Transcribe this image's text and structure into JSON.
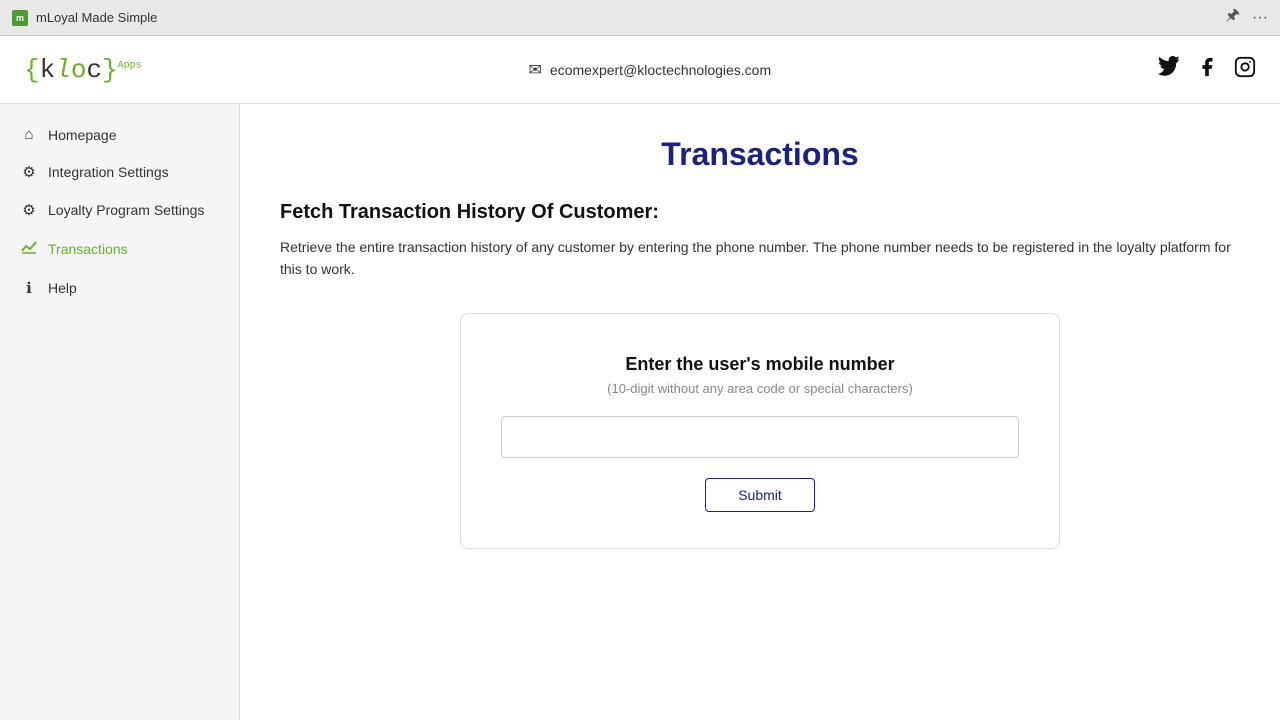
{
  "browser": {
    "tab_label": "mLoyal Made Simple",
    "pin_icon": "📌",
    "more_icon": "···"
  },
  "header": {
    "logo_text": "{kloc}",
    "email": "ecomexpert@kloctechnologies.com",
    "social": [
      "twitter",
      "facebook",
      "instagram"
    ]
  },
  "sidebar": {
    "items": [
      {
        "id": "homepage",
        "label": "Homepage",
        "icon": "home",
        "active": false
      },
      {
        "id": "integration-settings",
        "label": "Integration Settings",
        "icon": "gear",
        "active": false
      },
      {
        "id": "loyalty-program-settings",
        "label": "Loyalty Program Settings",
        "icon": "gear",
        "active": false
      },
      {
        "id": "transactions",
        "label": "Transactions",
        "icon": "chart",
        "active": true
      },
      {
        "id": "help",
        "label": "Help",
        "icon": "info",
        "active": false
      }
    ]
  },
  "main": {
    "page_title": "Transactions",
    "section_title": "Fetch Transaction History Of Customer:",
    "section_desc": "Retrieve the entire transaction history of any customer by entering the phone number. The phone number needs to be registered in the loyalty platform for this to work.",
    "card": {
      "title": "Enter the user's mobile number",
      "subtitle": "(10-digit without any area code or special characters)",
      "input_placeholder": "",
      "submit_label": "Submit"
    }
  }
}
